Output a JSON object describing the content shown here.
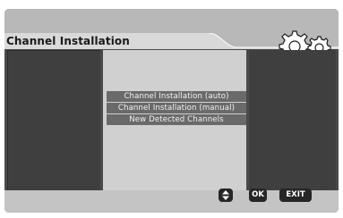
{
  "header": {
    "title": "Channel Installation",
    "icon": "gears-icon"
  },
  "menu": {
    "items": [
      {
        "label": "Channel  Installation (auto)"
      },
      {
        "label": "Channel  Installation (manual)"
      },
      {
        "label": "New Detected  Channels"
      }
    ]
  },
  "footer": {
    "updown_icon": "up-down-arrows-icon",
    "ok_label": "OK",
    "exit_label": "EXIT"
  },
  "colors": {
    "background": "#4a4a4a",
    "header": "#b8b8b8",
    "menu_item": "#6a6a6a",
    "center_panel": "#d0d0d0",
    "button": "#262626"
  }
}
